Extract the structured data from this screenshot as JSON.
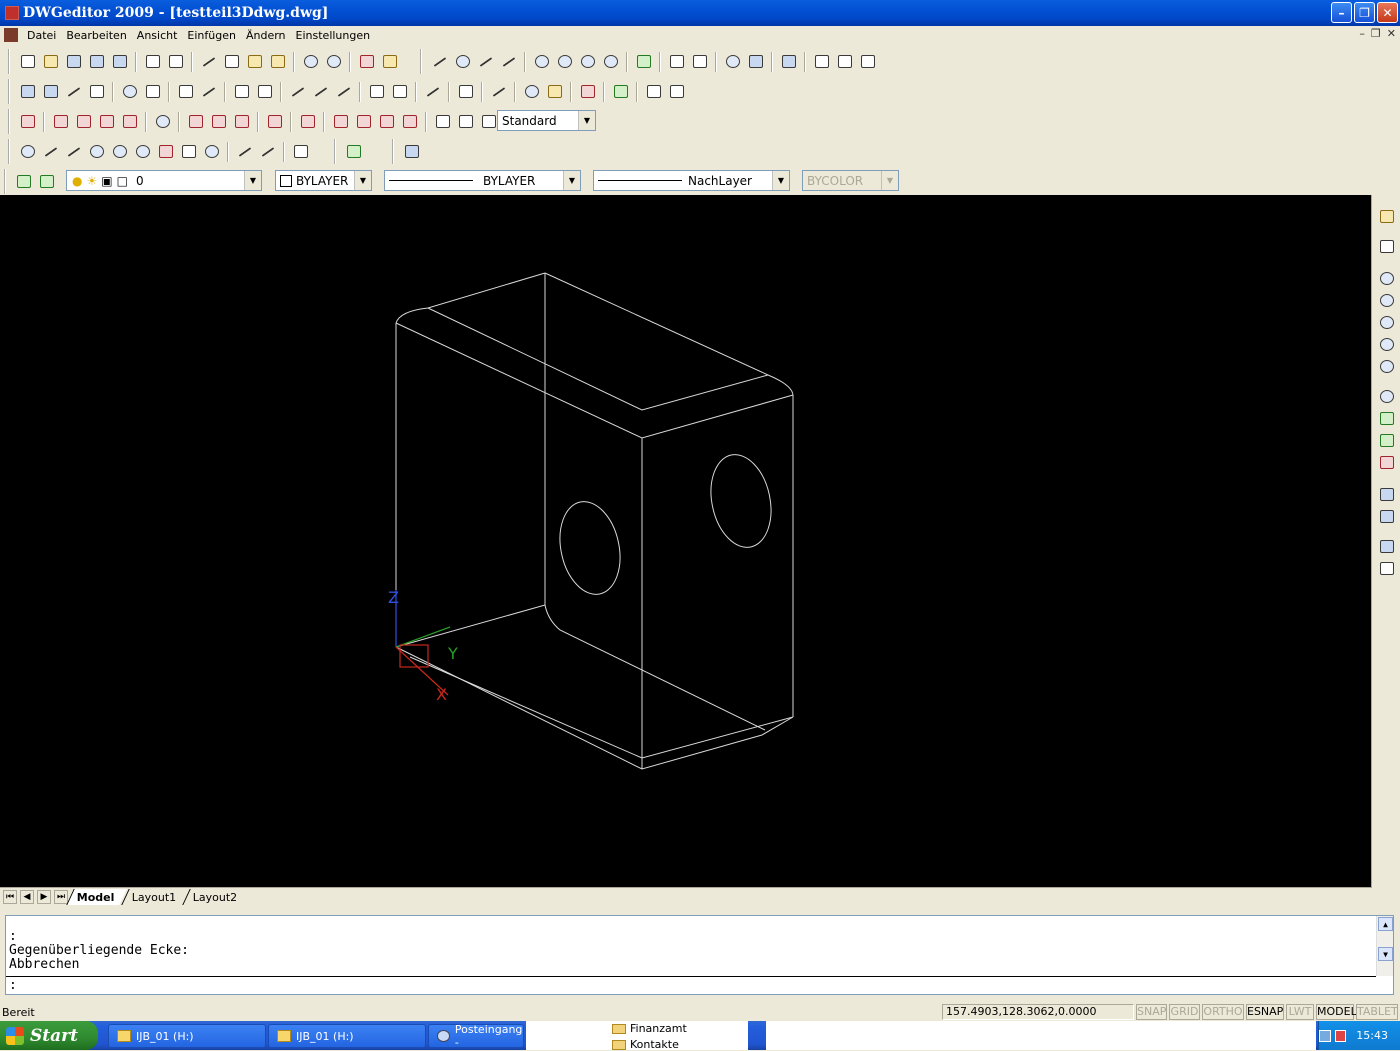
{
  "window": {
    "title": "DWGeditor 2009 - [testteil3Ddwg.dwg]"
  },
  "menu": [
    "Datei",
    "Bearbeiten",
    "Ansicht",
    "Einfügen",
    "Ändern",
    "Einstellungen"
  ],
  "toolbars": {
    "text_style": "Standard",
    "layer": "0",
    "color": "BYLAYER",
    "linetype": "BYLAYER",
    "lineweight": "NachLayer",
    "plotstyle": "BYCOLOR"
  },
  "tabs": [
    "Model",
    "Layout1",
    "Layout2"
  ],
  "active_tab": "Model",
  "command": {
    "history": [
      ":",
      "Gegenüberliegende Ecke:",
      "Abbrechen"
    ],
    "prompt": ":"
  },
  "status": {
    "text": "Bereit",
    "coords": "157.4903,128.3062,0.0000",
    "toggles": [
      {
        "label": "SNAP",
        "on": false
      },
      {
        "label": "GRID",
        "on": false
      },
      {
        "label": "ORTHO",
        "on": false
      },
      {
        "label": "ESNAP",
        "on": true
      },
      {
        "label": "LWT",
        "on": false
      },
      {
        "label": "MODEL",
        "on": true
      },
      {
        "label": "TABLET",
        "on": false
      }
    ]
  },
  "ucs": {
    "x": "X",
    "y": "Y",
    "z": "Z"
  },
  "taskbar": {
    "start": "Start",
    "tasks": [
      "IJB_01 (H:)",
      "IJB_01 (H:)",
      "Posteingang -"
    ],
    "folders": [
      "Finanzamt",
      "Kontakte"
    ],
    "clock": "15:43"
  },
  "colors": {
    "canvas": "#000000",
    "wire": "#d8d8d8",
    "x_axis": "#c8281e",
    "y_axis": "#28a028",
    "z_axis": "#3050e0"
  }
}
